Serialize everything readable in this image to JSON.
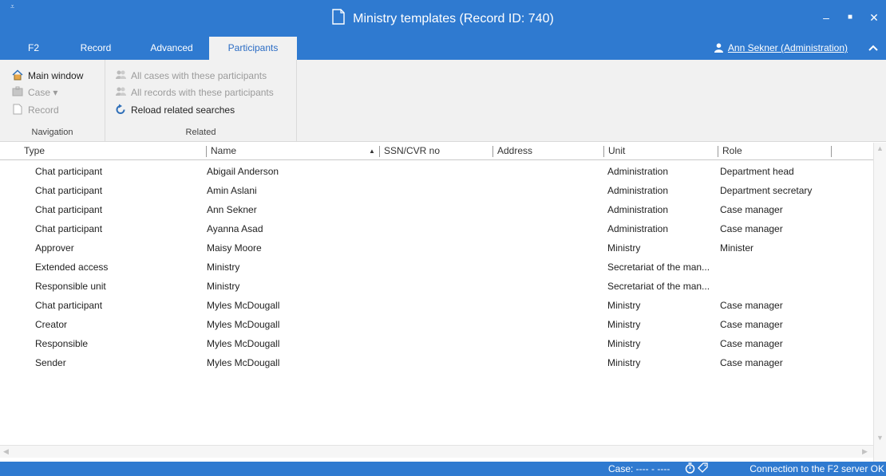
{
  "window": {
    "quick_access_glyph": "⩡",
    "title": "Ministry templates (Record ID: 740)",
    "minimize": "‒",
    "maximize": "■",
    "close": "✕"
  },
  "tabs": [
    {
      "label": "F2"
    },
    {
      "label": "Record"
    },
    {
      "label": "Advanced"
    },
    {
      "label": "Participants",
      "active": true
    }
  ],
  "user": {
    "label": "Ann Sekner (Administration)",
    "icon": "user-icon"
  },
  "ribbon": {
    "navigation": {
      "items": [
        {
          "label": "Main window",
          "icon": "home-icon",
          "enabled": true
        },
        {
          "label": "Case ▾",
          "icon": "case-icon",
          "enabled": false
        },
        {
          "label": "Record",
          "icon": "record-icon",
          "enabled": false
        }
      ],
      "group_label": "Navigation"
    },
    "related": {
      "items": [
        {
          "label": "All cases with these participants",
          "icon": "people-icon",
          "enabled": false
        },
        {
          "label": "All records with these participants",
          "icon": "people-icon",
          "enabled": false
        },
        {
          "label": "Reload related searches",
          "icon": "reload-icon",
          "enabled": true
        }
      ],
      "group_label": "Related"
    }
  },
  "table": {
    "columns": [
      "Type",
      "Name",
      "SSN/CVR no",
      "Address",
      "Unit",
      "Role"
    ],
    "sort_indicator": "▲",
    "rows": [
      [
        "Chat participant",
        "Abigail Anderson",
        "",
        "",
        "Administration",
        "Department head"
      ],
      [
        "Chat participant",
        "Amin Aslani",
        "",
        "",
        "Administration",
        "Department secretary"
      ],
      [
        "Chat participant",
        "Ann Sekner",
        "",
        "",
        "Administration",
        "Case manager"
      ],
      [
        "Chat participant",
        "Ayanna Asad",
        "",
        "",
        "Administration",
        "Case manager"
      ],
      [
        "Approver",
        "Maisy Moore",
        "",
        "",
        "Ministry",
        "Minister"
      ],
      [
        "Extended access",
        "Ministry",
        "",
        "",
        "Secretariat of the man...",
        ""
      ],
      [
        "Responsible unit",
        "Ministry",
        "",
        "",
        "Secretariat of the man...",
        ""
      ],
      [
        "Chat participant",
        "Myles McDougall",
        "",
        "",
        "Ministry",
        "Case manager"
      ],
      [
        "Creator",
        "Myles McDougall",
        "",
        "",
        "Ministry",
        "Case manager"
      ],
      [
        "Responsible",
        "Myles McDougall",
        "",
        "",
        "Ministry",
        "Case manager"
      ],
      [
        "Sender",
        "Myles McDougall",
        "",
        "",
        "Ministry",
        "Case manager"
      ]
    ]
  },
  "status": {
    "case": "Case: ---- - ----",
    "connection": "Connection to the F2 server OK"
  },
  "colors": {
    "accent": "#2f7ad0",
    "ribbon_bg": "#f1f1f1"
  }
}
